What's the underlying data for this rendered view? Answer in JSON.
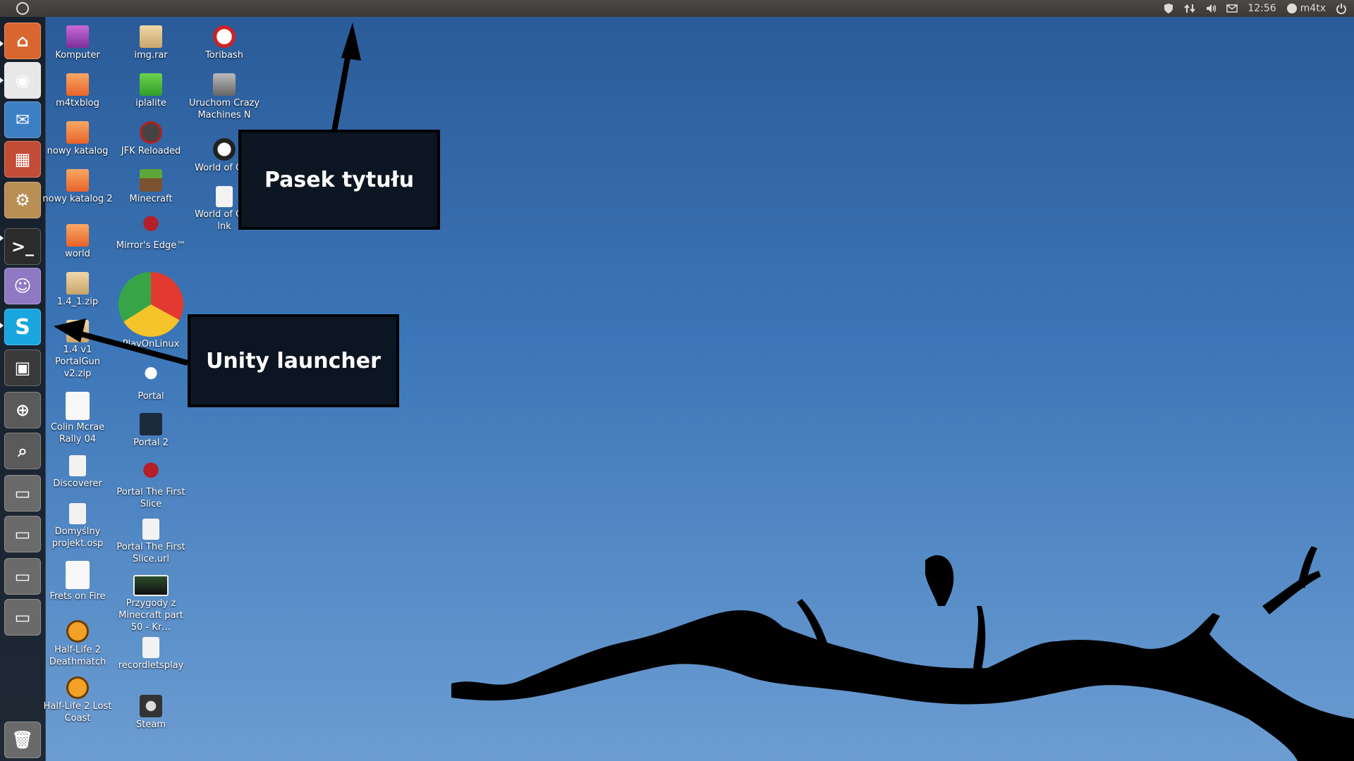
{
  "top_panel": {
    "time": "12:56",
    "user": "m4tx"
  },
  "launcher": {
    "items": [
      {
        "name": "launcher-home-folder",
        "icon": "home-folder-icon",
        "color": "#d9662f"
      },
      {
        "name": "launcher-chrome",
        "icon": "chrome-icon",
        "color": "#e8e8e8"
      },
      {
        "name": "launcher-thunderbird",
        "icon": "thunderbird-icon",
        "color": "#3d7fc4"
      },
      {
        "name": "launcher-software-center",
        "icon": "software-center-icon",
        "color": "#c24c36"
      },
      {
        "name": "launcher-ubuntu-software",
        "icon": "ubuntu-software-icon",
        "color": "#b98f56"
      },
      {
        "name": "launcher-terminal",
        "icon": "terminal-icon",
        "color": "#2b2b2b"
      },
      {
        "name": "launcher-pidgin",
        "icon": "pidgin-icon",
        "color": "#8e79c2"
      },
      {
        "name": "launcher-skype",
        "icon": "skype-icon",
        "color": "#19a5dd"
      },
      {
        "name": "launcher-workspace-switcher",
        "icon": "workspace-icon",
        "color": "#3a3a3a"
      },
      {
        "name": "launcher-magnifier",
        "icon": "zoom-icon",
        "color": "#5a5a5a"
      },
      {
        "name": "launcher-search",
        "icon": "search-icon",
        "color": "#5a5a5a"
      },
      {
        "name": "launcher-drive-1",
        "icon": "drive-icon",
        "color": "#6a6a6a"
      },
      {
        "name": "launcher-drive-2",
        "icon": "drive-icon",
        "color": "#6a6a6a"
      },
      {
        "name": "launcher-drive-3",
        "icon": "drive-icon",
        "color": "#6a6a6a"
      },
      {
        "name": "launcher-drive-4",
        "icon": "drive-icon",
        "color": "#6a6a6a"
      },
      {
        "name": "launcher-trash",
        "icon": "trash-icon",
        "color": "#6a6a6a"
      }
    ]
  },
  "desktop": {
    "icons": [
      {
        "label": "Komputer",
        "icon": "computer-icon"
      },
      {
        "label": "m4txblog",
        "icon": "folder-icon"
      },
      {
        "label": "nowy katalog",
        "icon": "folder-icon"
      },
      {
        "label": "nowy katalog 2",
        "icon": "folder-icon"
      },
      {
        "label": "world",
        "icon": "folder-icon"
      },
      {
        "label": "1.4_1.zip",
        "icon": "archive-icon"
      },
      {
        "label": "1.4 v1 PortalGun v2.zip",
        "icon": "archive-icon"
      },
      {
        "label": "Colin Mcrae Rally 04",
        "icon": "blank-file-icon"
      },
      {
        "label": "Discoverer",
        "icon": "document-icon"
      },
      {
        "label": "Domyślny projekt.osp",
        "icon": "document-icon"
      },
      {
        "label": "Frets on Fire",
        "icon": "blank-file-icon"
      },
      {
        "label": "Half-Life 2 Deathmatch",
        "icon": "half-life-icon"
      },
      {
        "label": "Half-Life 2 Lost Coast",
        "icon": "half-life-icon"
      },
      {
        "label": "img.rar",
        "icon": "archive-icon"
      },
      {
        "label": "iplalite",
        "icon": "ipla-icon"
      },
      {
        "label": "JFK Reloaded",
        "icon": "jfk-icon"
      },
      {
        "label": "Minecraft",
        "icon": "minecraft-icon"
      },
      {
        "label": "Mirror's Edge™",
        "icon": "wine-icon"
      },
      {
        "label": "PlayOnLinux",
        "icon": "playonlinux-icon"
      },
      {
        "label": "Portal",
        "icon": "portal-icon"
      },
      {
        "label": "Portal 2",
        "icon": "portal2-icon"
      },
      {
        "label": "Portal The First Slice",
        "icon": "wine-icon"
      },
      {
        "label": "Portal The First Slice.url",
        "icon": "document-icon"
      },
      {
        "label": "Przygody z Minecraft part 50 - Kr…",
        "icon": "video-thumbnail-icon"
      },
      {
        "label": "recordletsplay",
        "icon": "document-icon"
      },
      {
        "label": "Steam",
        "icon": "steam-icon"
      },
      {
        "label": "Toribash",
        "icon": "toribash-icon"
      },
      {
        "label": "Uruchom Crazy Machines N",
        "icon": "crazy-machines-icon"
      },
      {
        "label": "World of Goo",
        "icon": "world-of-goo-icon"
      },
      {
        "label": "World of Goo lnk",
        "icon": "document-icon"
      }
    ]
  },
  "annotations": {
    "title_bar": "Pasek tytułu",
    "launcher": "Unity launcher"
  }
}
